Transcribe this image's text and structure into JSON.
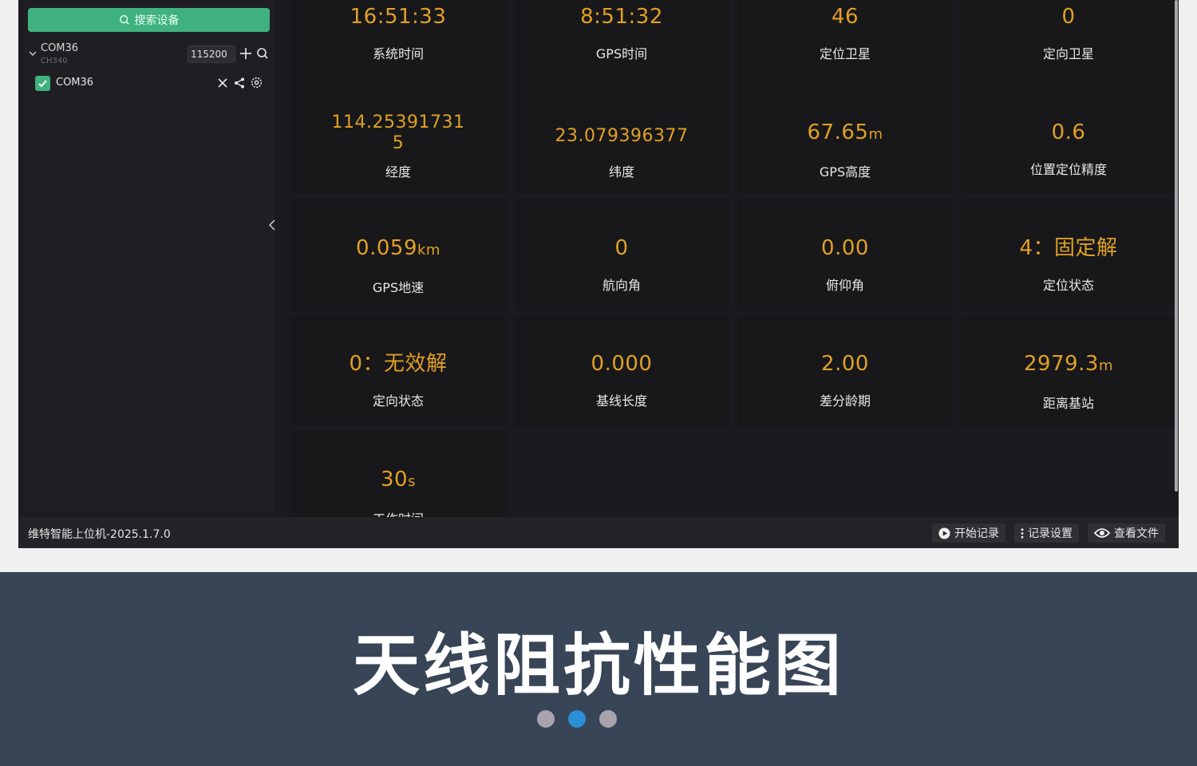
{
  "sidebar": {
    "search_button": "搜索设备",
    "device": {
      "name": "COM36",
      "chip": "CH340",
      "baud": "115200"
    },
    "port": {
      "name": "COM36",
      "checked": true
    }
  },
  "tiles": [
    {
      "value": "16:51:33",
      "unit": "",
      "label": "系统时间"
    },
    {
      "value": "8:51:32",
      "unit": "",
      "label": "GPS时间"
    },
    {
      "value": "46",
      "unit": "",
      "label": "定位卫星"
    },
    {
      "value": "0",
      "unit": "",
      "label": "定向卫星"
    },
    {
      "value": "114.25391731",
      "value2": "5",
      "unit": "",
      "label": "经度"
    },
    {
      "value": "23.079396377",
      "unit": "",
      "label": "纬度"
    },
    {
      "value": "67.65",
      "unit": "m",
      "label": "GPS高度"
    },
    {
      "value": "0.6",
      "unit": "",
      "label": "位置定位精度"
    },
    {
      "value": "0.059",
      "unit": "km",
      "label": "GPS地速"
    },
    {
      "value": "0",
      "unit": "",
      "label": "航向角"
    },
    {
      "value": "0.00",
      "unit": "",
      "label": "俯仰角"
    },
    {
      "value": "4：固定解",
      "unit": "",
      "label": "定位状态"
    },
    {
      "value": "0：无效解",
      "unit": "",
      "label": "定向状态"
    },
    {
      "value": "0.000",
      "unit": "",
      "label": "基线长度"
    },
    {
      "value": "2.00",
      "unit": "",
      "label": "差分龄期"
    },
    {
      "value": "2979.3",
      "unit": "m",
      "label": "距离基站"
    },
    {
      "value": "30",
      "unit": "s",
      "label": "工作时间"
    }
  ],
  "footer": {
    "version": "维特智能上位机-2025.1.7.0",
    "start_record": "开始记录",
    "record_settings": "记录设置",
    "view_files": "查看文件"
  },
  "banner": {
    "title": "天线阻抗性能图"
  },
  "colors": {
    "accent_green": "#3fb27f",
    "value_orange": "#e0a024",
    "banner_bg": "#384557",
    "dot_active": "#2a8fd6",
    "dot_inactive": "#a9a3ae"
  },
  "carousel": {
    "count": 3,
    "active_index": 1
  }
}
